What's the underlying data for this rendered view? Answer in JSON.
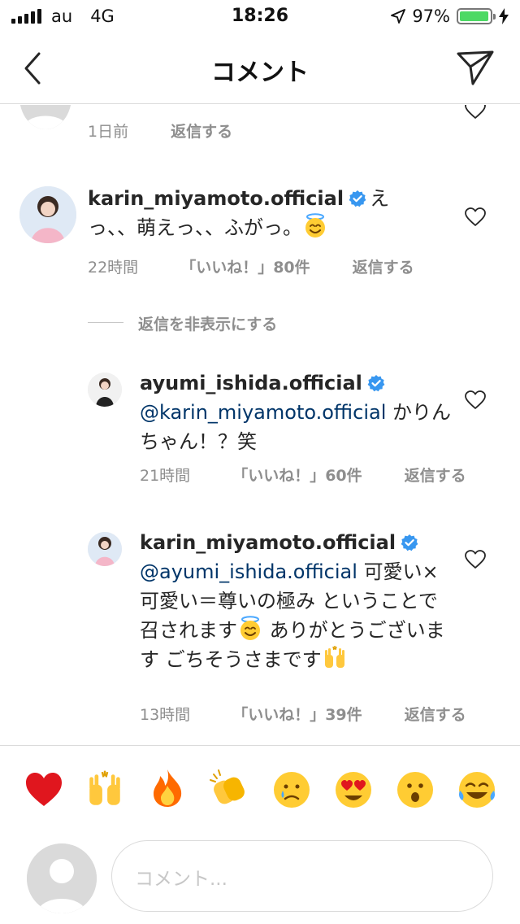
{
  "status_bar": {
    "carrier": "au",
    "network": "4G",
    "time": "18:26",
    "battery": "97%",
    "battery_level": 0.97
  },
  "header": {
    "title": "コメント",
    "back_icon": "chevron-left-icon",
    "send_icon": "paper-plane-icon"
  },
  "comments": [
    {
      "time": "1日前",
      "reply_label": "返信する"
    },
    {
      "username": "karin_miyamoto.official",
      "text": "えっ、、萌えっ、、ふがっ。",
      "emoji": "smiling-face-with-halo",
      "time": "22時間",
      "likes": "「いいね！」80件",
      "reply_label": "返信する"
    }
  ],
  "hide_replies_label": "返信を非表示にする",
  "replies": [
    {
      "username": "ayumi_ishida.official",
      "mention": "@karin_miyamoto.official",
      "text": "かりんちゃん！？笑",
      "time": "21時間",
      "likes": "「いいね！」60件",
      "reply_label": "返信する"
    },
    {
      "username": "karin_miyamoto.official",
      "mention": "@ayumi_ishida.official",
      "text_1": "可愛い×可愛い＝尊いの極み ということで召されます",
      "text_2": "ありがとうございます ごちそうさまです",
      "time": "13時間",
      "likes": "「いいね！」39件",
      "reply_label": "返信する"
    }
  ],
  "quick_reactions": [
    "red-heart",
    "raising-hands",
    "fire",
    "clapping-hands",
    "crying-face",
    "heart-eyes-face",
    "surprised-face",
    "tears-of-joy-face"
  ],
  "composer": {
    "placeholder": "コメント..."
  },
  "colors": {
    "verified": "#3897f0",
    "mention": "#003569",
    "meta": "#8e8e8e",
    "battery": "#4cd964"
  }
}
